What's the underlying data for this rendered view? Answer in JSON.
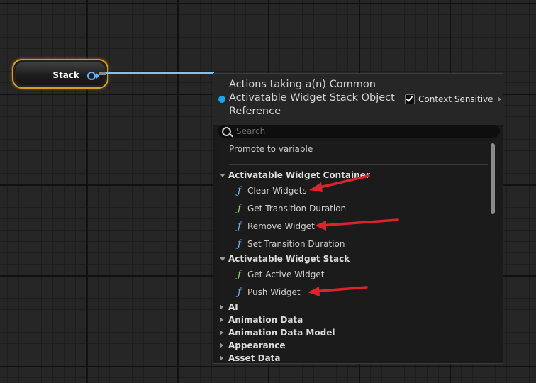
{
  "node": {
    "label": "Stack",
    "accent": "#d99d20",
    "pin_color": "#5fb3ff"
  },
  "panel": {
    "title_lines": [
      "Actions taking a(n) Common",
      "Activatable Widget Stack Object",
      "Reference"
    ],
    "context_sensitive_label": "Context Sensitive",
    "context_sensitive_checked": true,
    "search_placeholder": "Search",
    "promote_label": "Promote to variable"
  },
  "categories": [
    {
      "label": "Activatable Widget Container",
      "expanded": true,
      "items": [
        {
          "label": "Clear Widgets",
          "icon": "function-icon",
          "icon_color": "#73b7ff"
        },
        {
          "label": "Get Transition Duration",
          "icon": "function-icon",
          "icon_color": "#8fdb6e"
        },
        {
          "label": "Remove Widget",
          "icon": "function-icon",
          "icon_color": "#73b7ff"
        },
        {
          "label": "Set Transition Duration",
          "icon": "function-icon",
          "icon_color": "#73b7ff"
        }
      ]
    },
    {
      "label": "Activatable Widget Stack",
      "expanded": true,
      "items": [
        {
          "label": "Get Active Widget",
          "icon": "function-icon",
          "icon_color": "#8fdb6e"
        },
        {
          "label": "Push Widget",
          "icon": "function-icon",
          "icon_color": "#73b7ff"
        }
      ]
    }
  ],
  "collapsed_categories": [
    "AI",
    "Animation Data",
    "Animation Data Model",
    "Appearance",
    "Asset Data"
  ],
  "annotation_color": "#e0232b",
  "function_glyph": "ƒ"
}
